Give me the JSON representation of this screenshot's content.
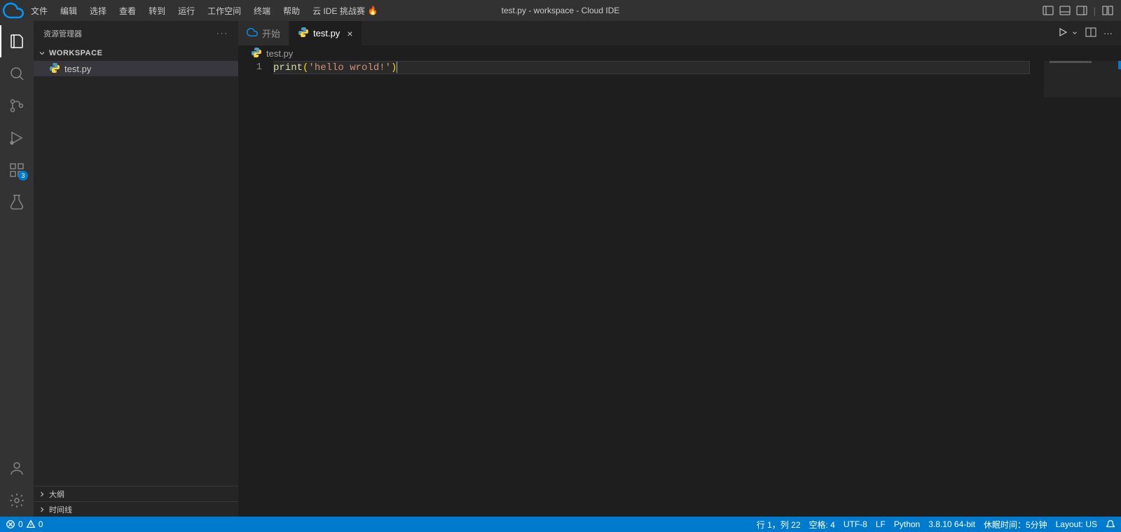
{
  "menubar": {
    "items": [
      "文件",
      "编辑",
      "选择",
      "查看",
      "转到",
      "运行",
      "工作空间",
      "终端",
      "帮助"
    ],
    "challenge": "云 IDE 挑战赛",
    "flame": "🔥",
    "windowTitle": "test.py - workspace - Cloud IDE"
  },
  "activitybar": {
    "extensionsBadge": "3"
  },
  "sidebar": {
    "title": "资源管理器",
    "workspace": "WORKSPACE",
    "files": [
      {
        "name": "test.py"
      }
    ],
    "outline": "大纲",
    "timeline": "时间线"
  },
  "tabs": {
    "start": "开始",
    "file": "test.py"
  },
  "breadcrumbs": {
    "file": "test.py"
  },
  "code": {
    "lineNum": "1",
    "fn": "print",
    "lp": "(",
    "str": "'hello wrold!'",
    "rp": ")"
  },
  "statusbar": {
    "errors": "0",
    "warnings": "0",
    "lineCol": "行 1，列 22",
    "spaces": "空格: 4",
    "encoding": "UTF-8",
    "eol": "LF",
    "lang": "Python",
    "interp": "3.8.10 64-bit",
    "idle": "休眠时间：5分钟",
    "layout": "Layout: US"
  }
}
